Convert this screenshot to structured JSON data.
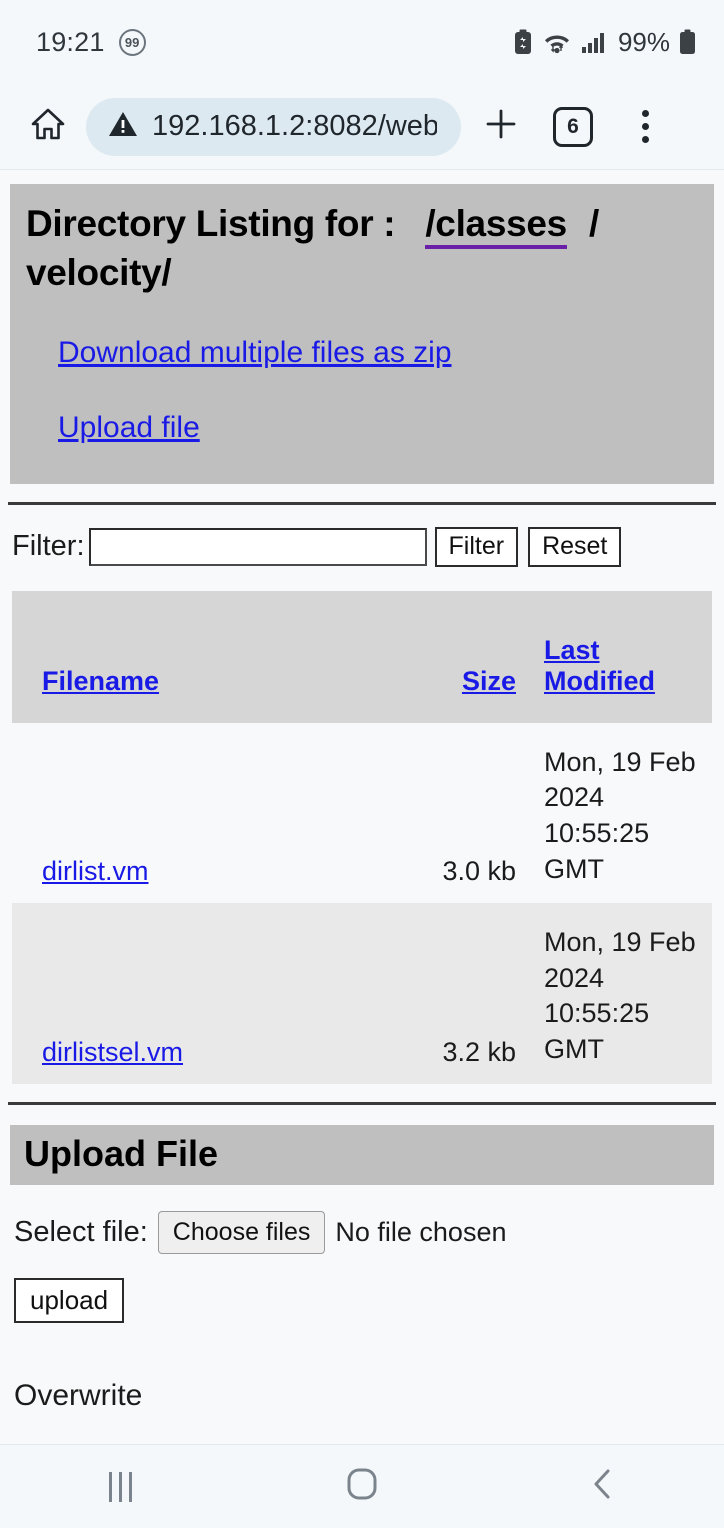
{
  "status_bar": {
    "clock": "19:21",
    "notification_badge": "99",
    "battery_percent": "99%",
    "icons": [
      "battery-saver-icon",
      "wifi-icon",
      "signal-bars-icon",
      "battery-icon"
    ]
  },
  "browser": {
    "home_icon": "home-icon",
    "security_icon": "not-secure-warning-icon",
    "url": "192.168.1.2:8082/web",
    "new_tab_label": "+",
    "tab_count": "6",
    "menu_icon": "overflow-menu-icon"
  },
  "page": {
    "title_prefix": "Directory Listing for :",
    "title_link": "/classes",
    "title_suffix": "/ velocity/",
    "links": {
      "download_zip": "Download multiple files as zip",
      "upload_file": "Upload file"
    },
    "filter": {
      "label": "Filter:",
      "value": "",
      "placeholder": "",
      "filter_button": "Filter",
      "reset_button": "Reset"
    },
    "table": {
      "headers": {
        "filename": "Filename",
        "size": "Size",
        "last_modified": "Last Modified"
      },
      "rows": [
        {
          "filename": "dirlist.vm",
          "size": "3.0 kb",
          "modified": "Mon, 19 Feb 2024 10:55:25 GMT"
        },
        {
          "filename": "dirlistsel.vm",
          "size": "3.2 kb",
          "modified": "Mon, 19 Feb 2024 10:55:25 GMT"
        }
      ]
    },
    "upload": {
      "heading": "Upload File",
      "select_label": "Select file:",
      "choose_button": "Choose files",
      "no_file_text": "No file chosen",
      "upload_button": "upload",
      "overwrite_label": "Overwrite"
    },
    "colors": {
      "band_gray": "#bfbfbf",
      "link_blue": "#1a1ae6",
      "visited_purple": "#6a21a8",
      "row_stripe": "#e9e9e9",
      "header_row": "#d6d6d6"
    }
  },
  "nav_bar": {
    "recents": "recents-icon",
    "home": "home-icon",
    "back": "back-icon"
  }
}
